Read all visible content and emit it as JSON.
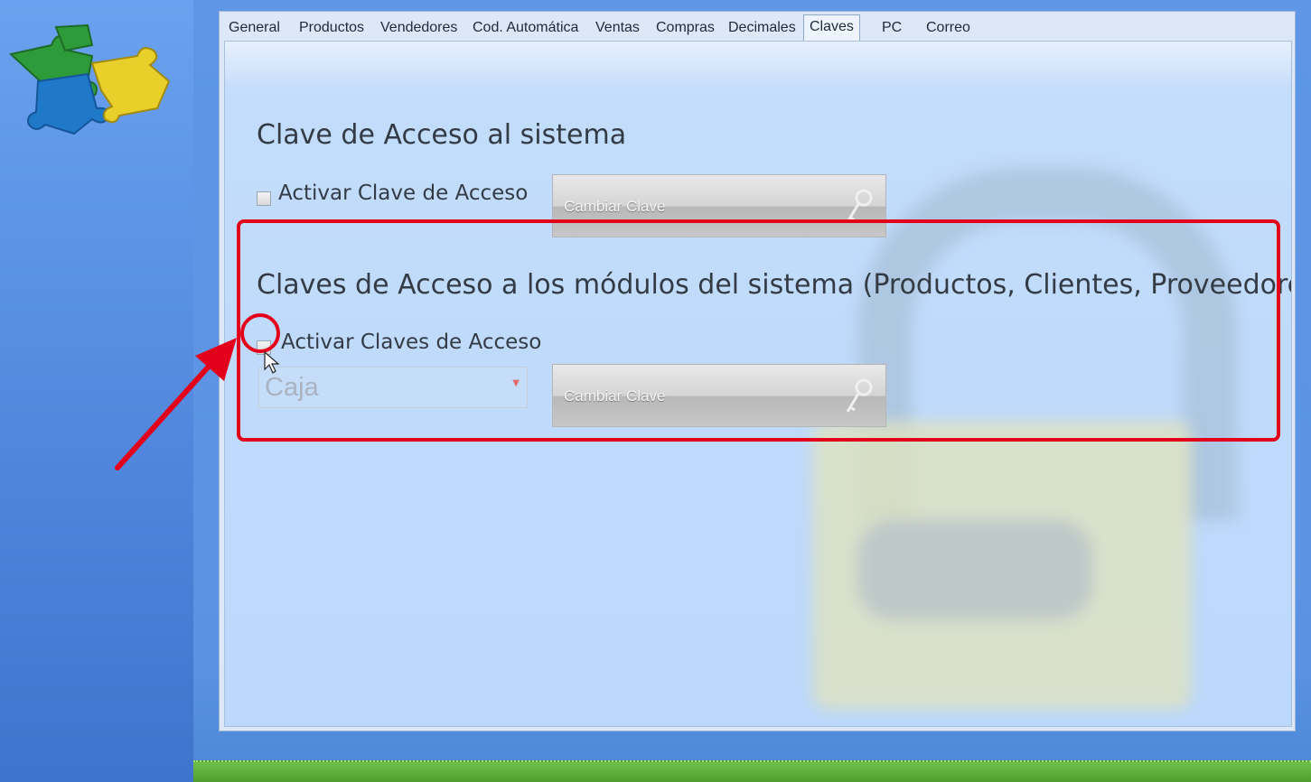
{
  "tabs": [
    {
      "label": "General"
    },
    {
      "label": "Productos"
    },
    {
      "label": "Vendedores"
    },
    {
      "label": "Cod. Automática"
    },
    {
      "label": "Ventas"
    },
    {
      "label": "Compras"
    },
    {
      "label": "Decimales"
    },
    {
      "label": "Claves",
      "active": true
    },
    {
      "label": "PC"
    },
    {
      "label": "Correo"
    }
  ],
  "section_system": {
    "title": "Clave de Acceso al sistema",
    "checkbox_label": "Activar Clave de Acceso",
    "checked": false,
    "button_label": "Cambiar Clave"
  },
  "section_modules": {
    "title": "Claves de Acceso a los módulos del sistema (Productos, Clientes, Proveedores, etc)",
    "checkbox_label": "Activar Claves de Acceso",
    "checked": false,
    "select_value": "Caja",
    "button_label": "Cambiar Clave"
  },
  "colors": {
    "highlight": "#e3001b",
    "sidebar": "#4f86dc",
    "panel": "#c3dcfb"
  },
  "icons": [
    "puzzle-logo-icon",
    "key-icon",
    "mouse-cursor-icon",
    "chevron-down-icon"
  ]
}
